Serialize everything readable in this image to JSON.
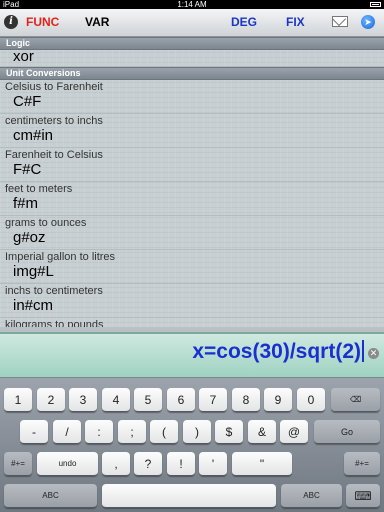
{
  "status": {
    "carrier": "iPad",
    "time": "1:14 AM"
  },
  "toolbar": {
    "info": "i",
    "func": "FUNC",
    "var": "VAR",
    "deg": "DEG",
    "fix": "FIX"
  },
  "list": {
    "logic_header": "Logic",
    "logic_items": [
      {
        "cmd": "xor"
      }
    ],
    "unit_header": "Unit Conversions",
    "unit_items": [
      {
        "desc": "Celsius to Farenheit",
        "cmd": "C#F"
      },
      {
        "desc": "centimeters to inchs",
        "cmd": "cm#in"
      },
      {
        "desc": "Farenheit to Celsius",
        "cmd": "F#C"
      },
      {
        "desc": "feet to meters",
        "cmd": "f#m"
      },
      {
        "desc": "grams to ounces",
        "cmd": "g#oz"
      },
      {
        "desc": "Imperial gallon to litres",
        "cmd": "img#L"
      },
      {
        "desc": "inchs to centimeters",
        "cmd": "in#cm"
      },
      {
        "desc": "kilograms to pounds",
        "cmd": ""
      }
    ]
  },
  "input": {
    "expression": "x=cos(30)/sqrt(2)"
  },
  "keyboard": {
    "row1": [
      "1",
      "2",
      "3",
      "4",
      "5",
      "6",
      "7",
      "8",
      "9",
      "0"
    ],
    "row2": [
      "-",
      "/",
      ":",
      ";",
      "(",
      ")",
      "$",
      "&",
      "@",
      "Go"
    ],
    "row3": [
      "#+=",
      "undo",
      ",",
      "?",
      "!",
      "'",
      "\"",
      "#+="
    ],
    "row4": [
      "ABC",
      "ABC"
    ]
  },
  "colors": {
    "func": "#e2231a",
    "mode": "#1936c8",
    "expression": "#1a2fd0"
  }
}
